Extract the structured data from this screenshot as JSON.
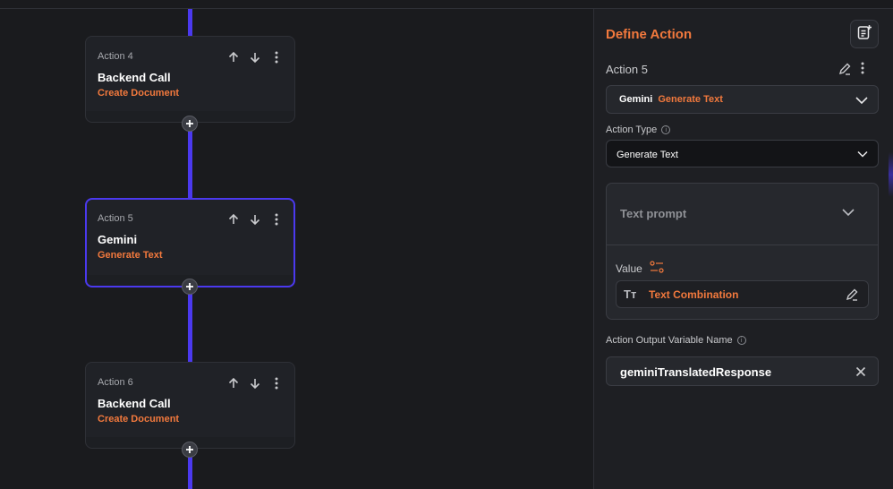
{
  "flow": {
    "cards": [
      {
        "caption": "Action 4",
        "title": "Backend Call",
        "subtitle": "Create Document"
      },
      {
        "caption": "Action 5",
        "title": "Gemini",
        "subtitle": "Generate Text"
      },
      {
        "caption": "Action 6",
        "title": "Backend Call",
        "subtitle": "Create Document"
      }
    ],
    "add_symbol": "+"
  },
  "panel": {
    "title": "Define Action",
    "action_label": "Action 5",
    "action_select": {
      "category": "Gemini",
      "action": "Generate Text"
    },
    "action_type": {
      "label": "Action Type",
      "value": "Generate Text"
    },
    "text_prompt": {
      "label": "Text prompt",
      "value_label": "Value",
      "type_symbol": "Tт",
      "value": "Text Combination"
    },
    "output_variable": {
      "label": "Action Output Variable Name",
      "value": "geminiTranslatedResponse"
    }
  },
  "colors": {
    "accent": "#f2793d",
    "connector": "#4b39ef",
    "background": "#1a1b1e"
  }
}
